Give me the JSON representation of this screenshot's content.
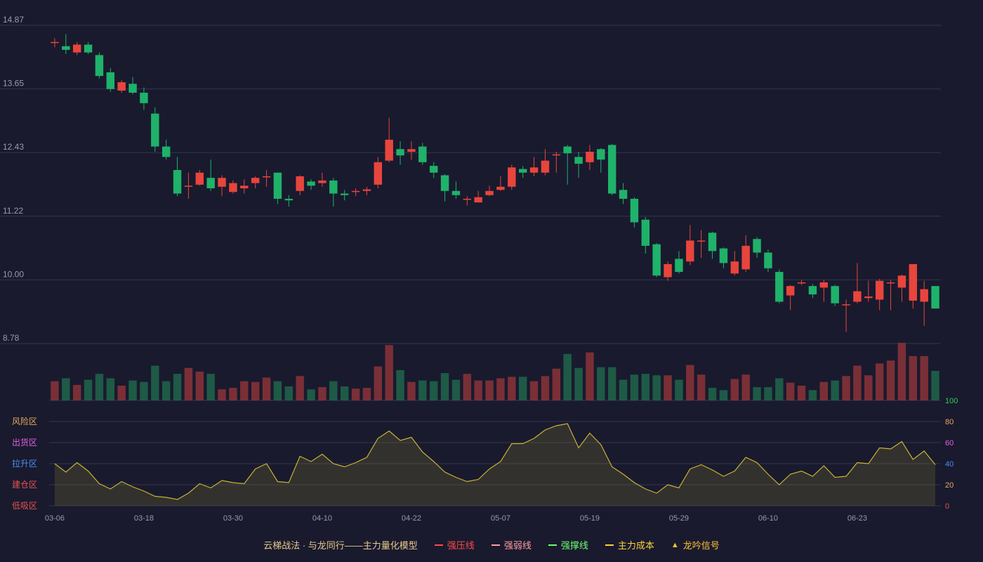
{
  "chart_data": {
    "type": "candlestick",
    "price_ticks": [
      "14.87",
      "13.65",
      "12.43",
      "11.22",
      "10.00",
      "8.78"
    ],
    "price_range": [
      8.78,
      14.87
    ],
    "x_labels": [
      "03-06",
      "03-18",
      "03-30",
      "04-10",
      "04-22",
      "05-07",
      "05-19",
      "05-29",
      "06-10",
      "06-23"
    ],
    "x_label_index": [
      0,
      8,
      16,
      24,
      32,
      40,
      48,
      56,
      64,
      72
    ],
    "ohlc": [
      [
        14.55,
        14.55,
        14.62,
        14.45
      ],
      [
        14.47,
        14.4,
        14.7,
        14.32
      ],
      [
        14.35,
        14.5,
        14.55,
        14.3
      ],
      [
        14.5,
        14.35,
        14.55,
        14.32
      ],
      [
        14.3,
        13.9,
        14.35,
        13.85
      ],
      [
        13.97,
        13.65,
        14.05,
        13.6
      ],
      [
        13.62,
        13.78,
        13.82,
        13.58
      ],
      [
        13.75,
        13.58,
        13.88,
        13.55
      ],
      [
        13.58,
        13.38,
        13.68,
        13.25
      ],
      [
        13.18,
        12.55,
        13.3,
        12.45
      ],
      [
        12.55,
        12.35,
        12.68,
        12.3
      ],
      [
        12.1,
        11.65,
        12.35,
        11.6
      ],
      [
        11.78,
        11.8,
        12.05,
        11.55
      ],
      [
        11.82,
        12.05,
        12.1,
        11.8
      ],
      [
        11.95,
        11.75,
        12.3,
        11.7
      ],
      [
        11.78,
        11.95,
        12.0,
        11.6
      ],
      [
        11.68,
        11.85,
        11.9,
        11.65
      ],
      [
        11.75,
        11.8,
        11.92,
        11.65
      ],
      [
        11.85,
        11.95,
        11.98,
        11.75
      ],
      [
        11.98,
        11.98,
        12.1,
        11.78
      ],
      [
        12.05,
        11.55,
        12.05,
        11.45
      ],
      [
        11.55,
        11.52,
        11.62,
        11.4
      ],
      [
        11.7,
        11.98,
        12.0,
        11.62
      ],
      [
        11.88,
        11.8,
        11.92,
        11.72
      ],
      [
        11.85,
        11.9,
        12.05,
        11.78
      ],
      [
        11.9,
        11.65,
        11.95,
        11.4
      ],
      [
        11.65,
        11.62,
        11.72,
        11.52
      ],
      [
        11.68,
        11.7,
        11.75,
        11.6
      ],
      [
        11.7,
        11.73,
        11.78,
        11.62
      ],
      [
        11.82,
        12.25,
        12.35,
        11.75
      ],
      [
        12.28,
        12.68,
        13.1,
        12.25
      ],
      [
        12.5,
        12.38,
        12.65,
        12.2
      ],
      [
        12.45,
        12.5,
        12.65,
        12.3
      ],
      [
        12.55,
        12.25,
        12.62,
        12.2
      ],
      [
        12.18,
        12.05,
        12.25,
        11.95
      ],
      [
        12.0,
        11.7,
        12.02,
        11.5
      ],
      [
        11.7,
        11.62,
        11.88,
        11.55
      ],
      [
        11.55,
        11.55,
        11.6,
        11.42
      ],
      [
        11.48,
        11.58,
        11.7,
        11.48
      ],
      [
        11.62,
        11.7,
        11.8,
        11.6
      ],
      [
        11.72,
        11.78,
        11.98,
        11.7
      ],
      [
        11.78,
        12.15,
        12.2,
        11.72
      ],
      [
        12.12,
        12.05,
        12.18,
        11.95
      ],
      [
        12.05,
        12.15,
        12.35,
        11.98
      ],
      [
        12.05,
        12.28,
        12.5,
        12.0
      ],
      [
        12.38,
        12.4,
        12.45,
        12.05
      ],
      [
        12.55,
        12.42,
        12.58,
        11.82
      ],
      [
        12.35,
        12.22,
        12.45,
        11.95
      ],
      [
        12.25,
        12.45,
        12.58,
        12.1
      ],
      [
        12.5,
        12.3,
        12.52,
        12.05
      ],
      [
        12.58,
        11.65,
        12.6,
        11.62
      ],
      [
        11.72,
        11.55,
        11.85,
        11.45
      ],
      [
        11.55,
        11.1,
        11.58,
        11.0
      ],
      [
        11.15,
        10.65,
        11.2,
        10.5
      ],
      [
        10.68,
        10.08,
        10.7,
        10.05
      ],
      [
        10.05,
        10.3,
        10.35,
        9.98
      ],
      [
        10.4,
        10.15,
        10.55,
        10.12
      ],
      [
        10.35,
        10.75,
        11.05,
        10.28
      ],
      [
        10.73,
        10.75,
        10.95,
        10.42
      ],
      [
        10.9,
        10.55,
        10.92,
        10.4
      ],
      [
        10.6,
        10.32,
        10.62,
        10.22
      ],
      [
        10.12,
        10.35,
        10.55,
        10.08
      ],
      [
        10.2,
        10.65,
        10.85,
        10.15
      ],
      [
        10.78,
        10.52,
        10.82,
        10.42
      ],
      [
        10.52,
        10.22,
        10.58,
        10.15
      ],
      [
        10.15,
        9.58,
        10.2,
        9.55
      ],
      [
        9.7,
        9.88,
        9.9,
        9.42
      ],
      [
        9.95,
        9.95,
        10.0,
        9.9
      ],
      [
        9.88,
        9.72,
        9.92,
        9.65
      ],
      [
        9.85,
        9.95,
        10.0,
        9.58
      ],
      [
        9.88,
        9.55,
        9.9,
        9.5
      ],
      [
        9.52,
        9.53,
        9.62,
        9.0
      ],
      [
        9.58,
        9.78,
        10.32,
        9.55
      ],
      [
        9.65,
        9.68,
        9.98,
        9.58
      ],
      [
        9.62,
        9.98,
        10.02,
        9.42
      ],
      [
        9.93,
        9.95,
        10.0,
        9.42
      ],
      [
        9.85,
        10.08,
        10.1,
        9.58
      ],
      [
        9.6,
        10.3,
        10.3,
        9.45
      ],
      [
        9.58,
        9.82,
        9.98,
        9.12
      ],
      [
        9.88,
        9.45,
        9.88,
        9.45
      ]
    ],
    "volume": [
      26,
      30,
      21,
      28,
      36,
      30,
      20,
      27,
      25,
      47,
      26,
      36,
      44,
      39,
      36,
      15,
      17,
      26,
      25,
      31,
      26,
      19,
      33,
      15,
      18,
      26,
      19,
      16,
      17,
      46,
      75,
      41,
      25,
      27,
      26,
      37,
      28,
      36,
      27,
      27,
      30,
      32,
      32,
      26,
      33,
      43,
      63,
      44,
      65,
      45,
      45,
      28,
      35,
      36,
      34,
      34,
      28,
      48,
      35,
      17,
      14,
      29,
      35,
      18,
      18,
      30,
      24,
      20,
      14,
      25,
      27,
      33,
      47,
      34,
      50,
      54,
      78,
      60,
      60,
      40
    ],
    "volume_max": 78,
    "oscillator": [
      40,
      32,
      41,
      33,
      21,
      16,
      23,
      18,
      14,
      9,
      8,
      6,
      12,
      21,
      17,
      24,
      22,
      21,
      35,
      40,
      23,
      22,
      47,
      42,
      49,
      40,
      37,
      41,
      46,
      64,
      71,
      62,
      65,
      51,
      42,
      32,
      27,
      23,
      25,
      35,
      42,
      59,
      59,
      64,
      72,
      76,
      78,
      55,
      69,
      58,
      37,
      30,
      22,
      16,
      12,
      20,
      17,
      35,
      39,
      34,
      28,
      33,
      46,
      41,
      30,
      20,
      30,
      33,
      28,
      38,
      27,
      28,
      41,
      40,
      55,
      54,
      61,
      44,
      52,
      39
    ],
    "oscillator_ticks": [
      "100",
      "80",
      "60",
      "40",
      "20",
      "0"
    ],
    "zones": [
      "风险区",
      "出货区",
      "拉升区",
      "建仓区",
      "低吸区"
    ],
    "zone_colors": [
      "#e8a85c",
      "#e060e0",
      "#4d8ef0",
      "#e85050",
      "#e85050"
    ],
    "osc_tick_colors": [
      "#2ecc52",
      "#e8a85c",
      "#e060e0",
      "#4d8ef0",
      "#e8a85c",
      "#e85050"
    ],
    "colors": {
      "up": "#e8453c",
      "down": "#1fb26a",
      "up_vol": "#7a2f36",
      "down_vol": "#1e5a46",
      "osc_line": "#c8b332",
      "grid": "#33354c",
      "tick": "#9a9aa8"
    }
  },
  "legend": {
    "title": "云梯战法 · 与龙同行——主力量化模型",
    "items": [
      {
        "label": "强压线",
        "color": "#ff4b4b"
      },
      {
        "label": "强弱线",
        "color": "#ff9ea0"
      },
      {
        "label": "强撑线",
        "color": "#6dff6d"
      },
      {
        "label": "主力成本",
        "color": "#ffd23c"
      },
      {
        "label": "龙吟信号",
        "color": "#ffc132"
      }
    ]
  }
}
